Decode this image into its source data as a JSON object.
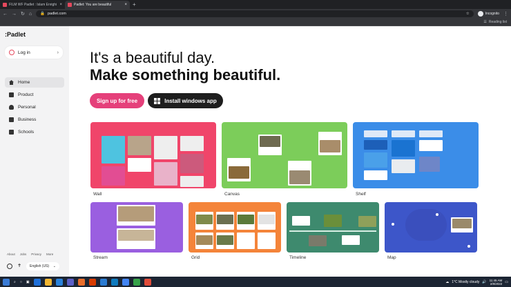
{
  "browser": {
    "tabs": [
      {
        "title": "FILM WF Padlet : Islam Enrighi",
        "color": "#e5485d"
      },
      {
        "title": "Padlet: You are beautiful",
        "color": "#e5485d"
      }
    ],
    "url": "padlet.com",
    "profile": "Incognito",
    "reading_list": "Reading list"
  },
  "sidebar": {
    "logo": ":Padlet",
    "login": "Log in",
    "nav": [
      {
        "label": "Home",
        "icon": "home-icon"
      },
      {
        "label": "Product",
        "icon": "product-icon"
      },
      {
        "label": "Personal",
        "icon": "person-icon"
      },
      {
        "label": "Business",
        "icon": "business-icon"
      },
      {
        "label": "Schools",
        "icon": "schools-icon"
      }
    ],
    "footer_links": [
      "About",
      "Jobs",
      "Privacy",
      "More"
    ],
    "language": "English (US)"
  },
  "main": {
    "heading1": "It's a beautiful day.",
    "heading2": "Make something beautiful.",
    "signup": "Sign up for free",
    "install": "Install windows app",
    "cards": [
      "Wall",
      "Canvas",
      "Shelf",
      "Stream",
      "Grid",
      "Timeline",
      "Map"
    ]
  },
  "taskbar": {
    "weather": "1°C  Mostly cloudy",
    "time": "11:45 AM",
    "date": "2/8/2022"
  },
  "colors": {
    "wall": "#f0456a",
    "canvas": "#7ccd5a",
    "shelf": "#3b8de8",
    "stream": "#9a5fe0",
    "grid": "#f4843a",
    "timeline": "#3e8a6e",
    "map": "#3d56c9"
  }
}
